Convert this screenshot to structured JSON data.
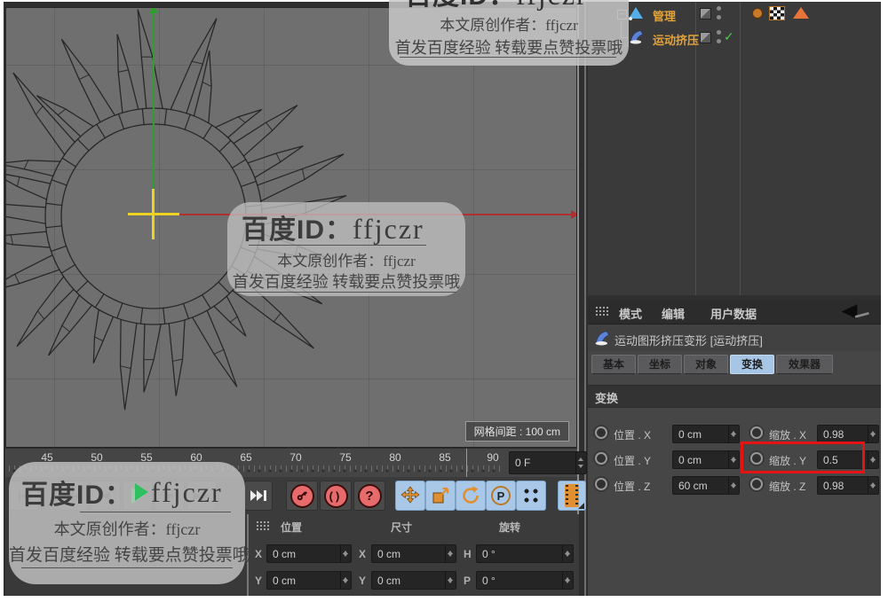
{
  "watermark": {
    "id_label": "百度ID：",
    "id_value": "ffjczr",
    "author_line": "本文原创作者：ffjczr",
    "footer_line": "首发百度经验 转载要点赞投票哦"
  },
  "viewport": {
    "grid_spacing_label": "网格间距 : 100 cm"
  },
  "timeline": {
    "ticks": [
      "45",
      "50",
      "55",
      "60",
      "65",
      "70",
      "75",
      "80",
      "85",
      "90"
    ],
    "frame_field": "0 F"
  },
  "object_manager": {
    "items": [
      {
        "label": "管理"
      },
      {
        "label": "运动挤压"
      }
    ]
  },
  "attribute_manager": {
    "menu": [
      "模式",
      "编辑",
      "用户数据"
    ],
    "title": "运动图形挤压变形 [运动挤压]",
    "tabs": [
      {
        "label": "基本"
      },
      {
        "label": "坐标"
      },
      {
        "label": "对象"
      },
      {
        "label": "变换"
      },
      {
        "label": "效果器"
      }
    ],
    "selected_tab": "变换",
    "section": "变换",
    "rows": [
      {
        "left_label": "位置 . X",
        "left_value": "0 cm",
        "right_label": "缩放 . X",
        "right_value": "0.98"
      },
      {
        "left_label": "位置 . Y",
        "left_value": "0 cm",
        "right_label": "缩放 . Y",
        "right_value": "0.5"
      },
      {
        "left_label": "位置 . Z",
        "left_value": "60 cm",
        "right_label": "缩放 . Z",
        "right_value": "0.98"
      }
    ],
    "highlighted_row": "缩放 . Y"
  },
  "coordinates": {
    "headers": [
      "位置",
      "尺寸",
      "旋转"
    ],
    "rows": [
      {
        "cells": [
          {
            "label": "X",
            "value": "0 cm"
          },
          {
            "label": "X",
            "value": "0 cm"
          },
          {
            "label": "H",
            "value": "0 °"
          }
        ]
      },
      {
        "cells": [
          {
            "label": "Y",
            "value": "0 cm"
          },
          {
            "label": "Y",
            "value": "0 cm"
          },
          {
            "label": "P",
            "value": "0 °"
          }
        ]
      }
    ]
  },
  "colors": {
    "om_item_orange": "#e3a33b",
    "selected_tab_blue": "#a7c6e6",
    "annotation_red": "#e41414",
    "axis_red": "#b03030",
    "axis_green": "#2e9e2e",
    "crosshair_yellow": "#ecd322"
  }
}
